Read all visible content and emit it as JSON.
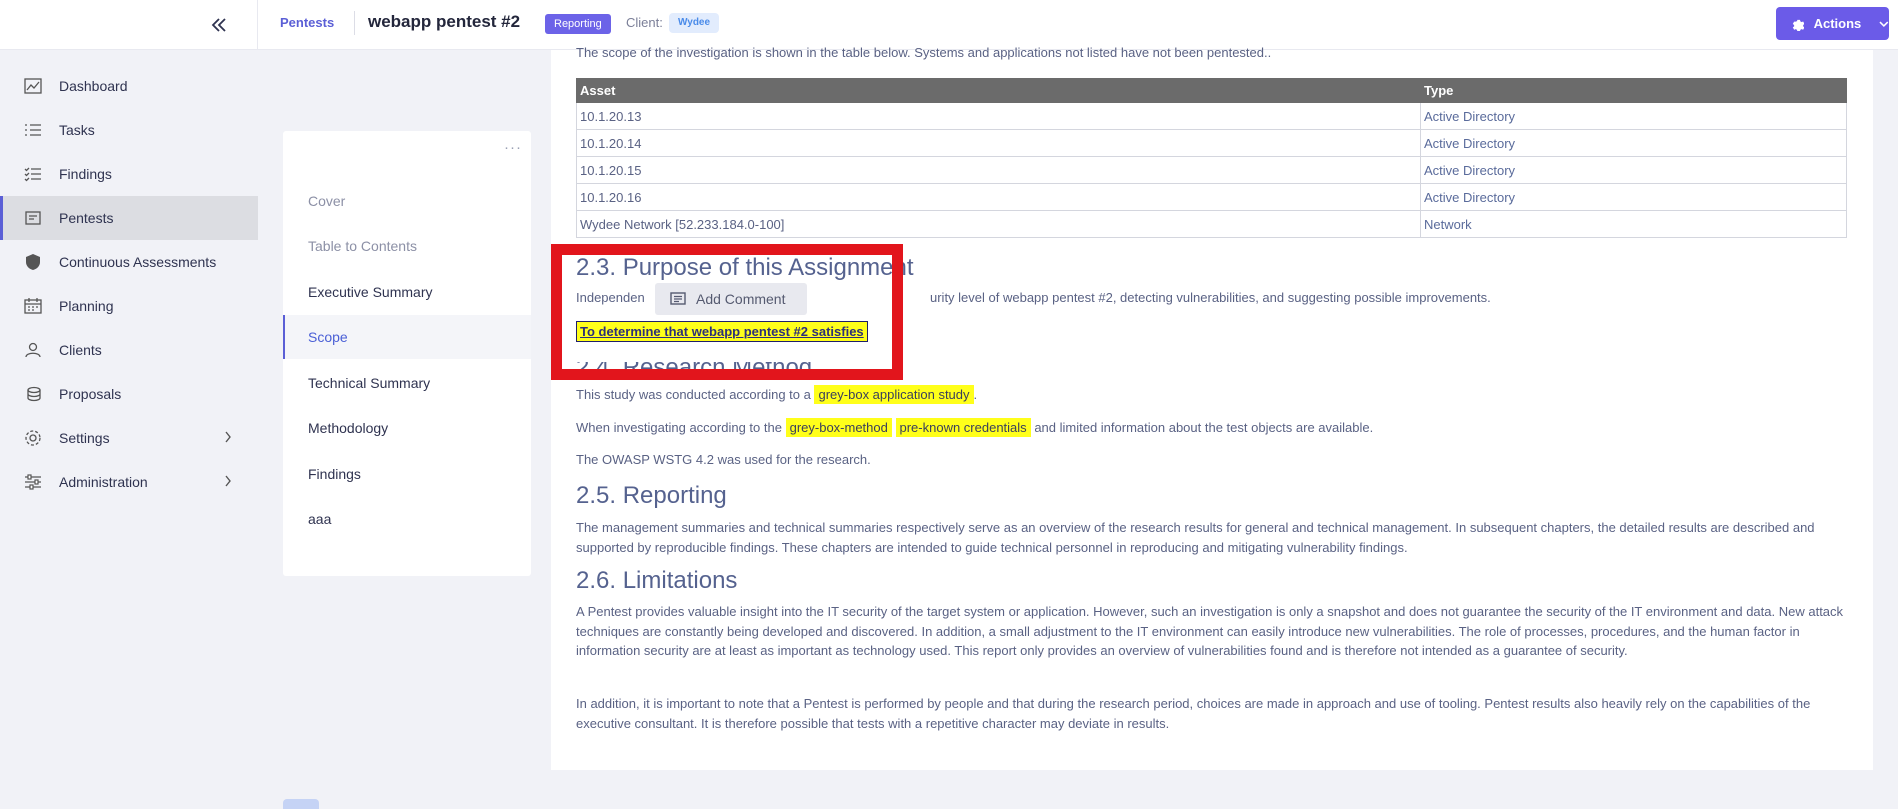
{
  "header": {
    "breadcrumb": "Pentests",
    "title": "webapp pentest #2",
    "status": "Reporting",
    "client_label": "Client:",
    "client_name": "Wydee",
    "actions_label": "Actions"
  },
  "sidebar": {
    "items": [
      {
        "label": "Dashboard",
        "icon": "chart-icon"
      },
      {
        "label": "Tasks",
        "icon": "list-icon"
      },
      {
        "label": "Findings",
        "icon": "checklist-icon"
      },
      {
        "label": "Pentests",
        "icon": "folder-icon",
        "active": true
      },
      {
        "label": "Continuous Assessments",
        "icon": "shield-icon"
      },
      {
        "label": "Planning",
        "icon": "calendar-icon"
      },
      {
        "label": "Clients",
        "icon": "user-icon"
      },
      {
        "label": "Proposals",
        "icon": "coins-icon"
      },
      {
        "label": "Settings",
        "icon": "gear-icon"
      },
      {
        "label": "Administration",
        "icon": "sliders-icon"
      }
    ]
  },
  "sections": {
    "menu_glyph": "···",
    "items": [
      {
        "label": "Cover"
      },
      {
        "label": "Table to Contents"
      },
      {
        "label": "Executive Summary"
      },
      {
        "label": "Scope",
        "active": true
      },
      {
        "label": "Technical Summary"
      },
      {
        "label": "Methodology"
      },
      {
        "label": "Findings"
      },
      {
        "label": "aaa"
      }
    ]
  },
  "document": {
    "scope_intro": "The scope of the investigation is shown in the table below. Systems and applications not listed have not been pentested..",
    "table": {
      "headers": [
        "Asset",
        "Type"
      ],
      "rows": [
        [
          "10.1.20.13",
          "Active Directory"
        ],
        [
          "10.1.20.14",
          "Active Directory"
        ],
        [
          "10.1.20.15",
          "Active Directory"
        ],
        [
          "10.1.20.16",
          "Active Directory"
        ],
        [
          "Wydee Network [52.233.184.0-100]",
          "Network"
        ]
      ]
    },
    "purpose_heading": "2.3. Purpose of this Assignment",
    "purpose_text_a": "Independen",
    "purpose_text_b": "urity level of webapp pentest #2, detecting vulnerabilities, and suggesting possible improvements.",
    "purpose_link": "To determine that webapp pentest #2 satisfies",
    "research_heading": "2.4. Research Method",
    "research_p1_a": "This study was conducted according to a",
    "research_p1_hl": "grey-box application study",
    "research_p1_b": ".",
    "research_p2_a": "When investigating according to the",
    "research_p2_hl1": "grey-box-method",
    "research_p2_hl2": "pre-known credentials",
    "research_p2_b": "and limited information about the test objects are available.",
    "research_p3": "The OWASP WSTG 4.2 was used for the research.",
    "reporting_heading": "2.5. Reporting",
    "reporting_text": "The management summaries and technical summaries respectively serve as an overview of the research results for general and technical management. In subsequent chapters, the detailed results are described and supported by reproducible findings. These chapters are intended to guide technical personnel in reproducing and mitigating vulnerability findings.",
    "limitations_heading": "2.6. Limitations",
    "limitations_p1": "A Pentest provides valuable insight into the IT security of the target system or application. However, such an investigation is only a snapshot and does not guarantee the security of the IT environment and data. New attack techniques are constantly being developed and discovered. In addition, a small adjustment to the IT environment can easily introduce new vulnerabilities. The role of processes, procedures, and the human factor in information security are at least as important as technology used. This report only provides an overview of vulnerabilities found and is therefore not intended as a guarantee of security.",
    "limitations_p2": "In addition, it is important to note that a Pentest is performed by people and that during the research period, choices are made in approach and use of tooling. Pentest results also heavily rely on the capabilities of the executive consultant. It is therefore possible that tests with a repetitive character may deviate in results."
  },
  "comment_popup": {
    "label": "Add Comment"
  }
}
